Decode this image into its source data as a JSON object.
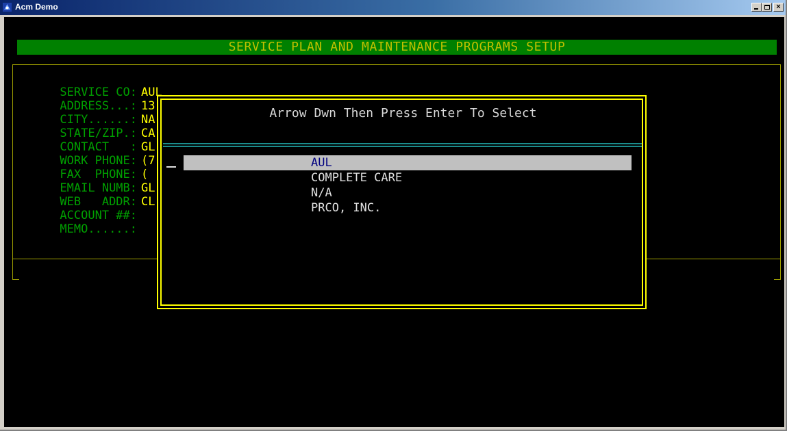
{
  "window": {
    "title": "Acm Demo",
    "controls": {
      "minimize": "_",
      "maximize": "□",
      "close": "×"
    }
  },
  "screen": {
    "header": "SERVICE PLAN AND MAINTENANCE PROGRAMS SETUP",
    "fields": [
      {
        "label": "SERVICE CO:",
        "value": "AUL"
      },
      {
        "label": "ADDRESS...:",
        "value": "13"
      },
      {
        "label": "CITY......:",
        "value": "NA"
      },
      {
        "label": "STATE/ZIP.:",
        "value": "CA"
      },
      {
        "label": "CONTACT   :",
        "value": "GL"
      },
      {
        "label": "WORK PHONE:",
        "value": "(7"
      },
      {
        "label": "FAX  PHONE:",
        "value": "("
      },
      {
        "label": "EMAIL NUMB:",
        "value": "GL"
      },
      {
        "label": "WEB   ADDR:",
        "value": "CL"
      },
      {
        "label": "ACCOUNT ##:",
        "value": ""
      },
      {
        "label": "MEMO......:",
        "value": ""
      }
    ]
  },
  "dialog": {
    "title": "Arrow Dwn Then Press Enter To Select",
    "items": [
      {
        "label": "AUL",
        "selected": true
      },
      {
        "label": "COMPLETE CARE",
        "selected": false
      },
      {
        "label": "N/A",
        "selected": false
      },
      {
        "label": "PRCO, INC.",
        "selected": false
      }
    ]
  },
  "colors": {
    "field_label": "#00a000",
    "field_value": "#ffff00",
    "header_bg": "#008000",
    "header_text": "#c0c000",
    "dialog_border": "#ffff00",
    "separator": "#1b8c8c",
    "selection_bg": "#c0c0c0",
    "selection_text": "#000080"
  }
}
